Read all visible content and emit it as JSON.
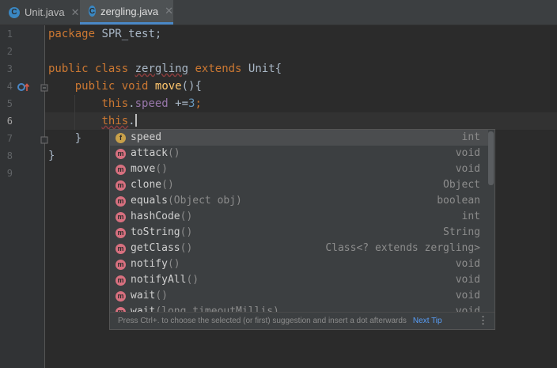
{
  "tabs": [
    {
      "icon": "C",
      "label": "Unit.java",
      "close": "✕"
    },
    {
      "icon": "C",
      "label": "zergling.java",
      "close": "✕"
    }
  ],
  "gutter": {
    "line_numbers": [
      "1",
      "2",
      "3",
      "4",
      "5",
      "6",
      "7",
      "8",
      "9"
    ]
  },
  "code": {
    "l1": {
      "kw": "package",
      "rest": " SPR_test;"
    },
    "l3": {
      "kw1": "public",
      "kw2": "class",
      "cls": "zergling",
      "kw3": "extends",
      "rest": " Unit{"
    },
    "l4": {
      "kw1": "public",
      "kw2": "void",
      "fn": "move",
      "rest": "(){"
    },
    "l5": {
      "kw": "this",
      "dot": ".",
      "fld": "speed",
      "op": " +=",
      "num": "3",
      "semi": ";"
    },
    "l6": {
      "kw": "this",
      "dot": "."
    },
    "l7": {
      "text": "}"
    },
    "l8": {
      "text": "}"
    }
  },
  "completion": {
    "items": [
      {
        "kind": "f",
        "name": "speed",
        "params": "",
        "type": "int"
      },
      {
        "kind": "m",
        "name": "attack",
        "params": "()",
        "type": "void"
      },
      {
        "kind": "m",
        "name": "move",
        "params": "()",
        "type": "void"
      },
      {
        "kind": "m",
        "name": "clone",
        "params": "()",
        "type": "Object"
      },
      {
        "kind": "m",
        "name": "equals",
        "params": "(Object obj)",
        "type": "boolean"
      },
      {
        "kind": "m",
        "name": "hashCode",
        "params": "()",
        "type": "int"
      },
      {
        "kind": "m",
        "name": "toString",
        "params": "()",
        "type": "String"
      },
      {
        "kind": "m",
        "name": "getClass",
        "params": "()",
        "type": "Class<? extends zergling>"
      },
      {
        "kind": "m",
        "name": "notify",
        "params": "()",
        "type": "void"
      },
      {
        "kind": "m",
        "name": "notifyAll",
        "params": "()",
        "type": "void"
      },
      {
        "kind": "m",
        "name": "wait",
        "params": "()",
        "type": "void"
      },
      {
        "kind": "m",
        "name": "wait",
        "params": "(long timeoutMillis)",
        "type": "void"
      }
    ],
    "footer_hint": "Press Ctrl+. to choose the selected (or first) suggestion and insert a dot afterwards",
    "next_tip": "Next Tip",
    "more_icon": "⋮"
  },
  "colors": {
    "background": "#2b2b2b",
    "keyword": "#cc7832",
    "field": "#9876aa",
    "number": "#6897bb",
    "method": "#ffc66d",
    "accent": "#4a88c7"
  }
}
